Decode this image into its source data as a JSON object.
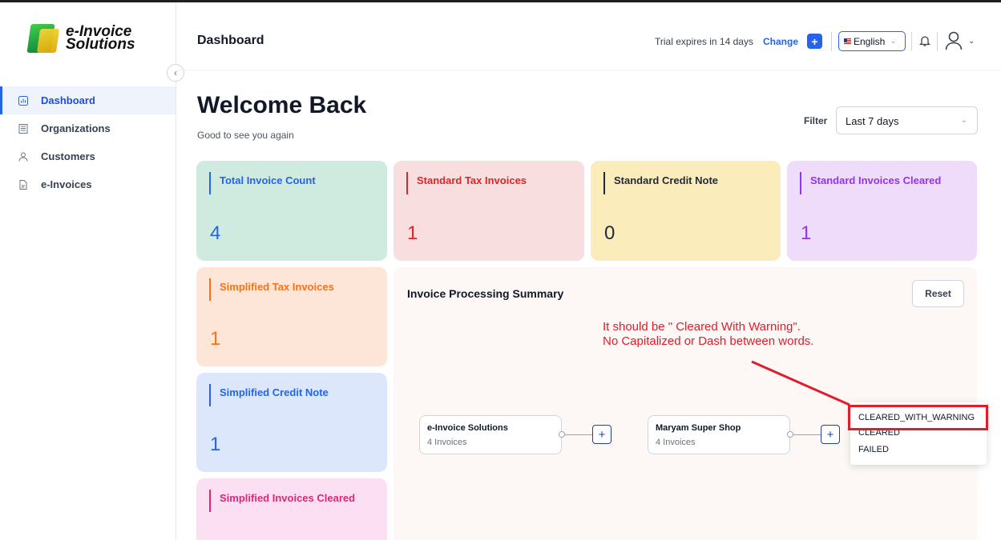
{
  "sidebar": {
    "logo_line1": "e-Invoice",
    "logo_line2": "Solutions",
    "items": [
      {
        "label": "Dashboard",
        "icon": "chart-icon",
        "active": true
      },
      {
        "label": "Organizations",
        "icon": "building-icon",
        "active": false
      },
      {
        "label": "Customers",
        "icon": "user-icon",
        "active": false
      },
      {
        "label": "e-Invoices",
        "icon": "document-icon",
        "active": false
      }
    ]
  },
  "header": {
    "title": "Dashboard",
    "trial_text": "Trial expires in 14 days",
    "change_label": "Change",
    "plus_label": "+",
    "language": "English"
  },
  "main": {
    "welcome": "Welcome Back",
    "subtitle": "Good to see you again",
    "filter_label": "Filter",
    "filter_value": "Last 7 days",
    "cards": [
      {
        "label": "Total Invoice Count",
        "value": "4",
        "color": "#2563eb",
        "bg": "#cfeadf"
      },
      {
        "label": "Standard Tax Invoices",
        "value": "1",
        "color": "#dc2626",
        "bg": "#f8dede"
      },
      {
        "label": "Standard Credit Note",
        "value": "0",
        "color": "#1f2937",
        "bg": "#fbecbc"
      },
      {
        "label": "Standard Invoices Cleared",
        "value": "1",
        "color": "#9333ea",
        "bg": "#efdcfb"
      },
      {
        "label": "Simplified Tax Invoices",
        "value": "1",
        "color": "#f97316",
        "bg": "#fde5d8"
      },
      {
        "label": "Simplified Credit Note",
        "value": "1",
        "color": "#2563eb",
        "bg": "#dce7fb"
      },
      {
        "label": "Simplified Invoices Cleared",
        "value": "",
        "color": "#db2777",
        "bg": "#fcdff2"
      }
    ]
  },
  "summary": {
    "title": "Invoice Processing Summary",
    "reset_label": "Reset",
    "nodes": [
      {
        "name": "e-Invoice Solutions",
        "count": "4 Invoices"
      },
      {
        "name": "Maryam Super Shop",
        "count": "4 Invoices"
      }
    ],
    "expand_label": "+",
    "dropdown": [
      "CLEARED_WITH_WARNING",
      "CLEARED",
      "FAILED"
    ]
  },
  "annotation": {
    "line1": "It should be \" Cleared With Warning\".",
    "line2": "No Capitalized or Dash between words.",
    "color": "#e11d2a"
  }
}
